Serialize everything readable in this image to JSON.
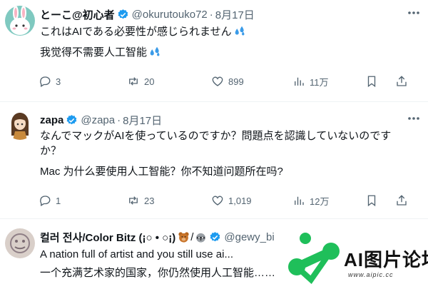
{
  "tweets": [
    {
      "name": "とーこ@初心者",
      "handle": "@okurutouko72",
      "dot": "·",
      "date": "8月17日",
      "lines": [
        "これはAIである必要性が感じられません",
        "我觉得不需要人工智能"
      ],
      "actions": {
        "replies": "3",
        "reposts": "20",
        "likes": "899",
        "views": "11万"
      },
      "icons": {
        "avatar": "bunny-avatar",
        "emoji": "sweat-droplets-emoji"
      }
    },
    {
      "name": "zapa",
      "handle": "@zapa",
      "dot": "·",
      "date": "8月17日",
      "lines": [
        "なんでマックがAIを使っているのですか？問題点を認識していないのですか？",
        "Mac 为什么要使用人工智能？你不知道问题所在吗?"
      ],
      "line1a": "なんでマックがAIを使っているのですか？問題点を認識していないのです",
      "line1b": "か？",
      "actions": {
        "replies": "1",
        "reposts": "23",
        "likes": "1,019",
        "views": "12万"
      },
      "icons": {
        "avatar": "anime-girl-avatar"
      }
    },
    {
      "name": "컬러 전사/Color Bitz (¡○ • ○¡)",
      "handle": "@gewy_bi",
      "lines": [
        "A nation full of artist and you still use ai...",
        "一个充满艺术家的国家，你仍然使用人工智能……"
      ],
      "icons": {
        "avatar": "doodle-avatar",
        "extra": [
          "bear-emoji",
          "raccoon-emoji"
        ]
      }
    }
  ],
  "watermark": {
    "text": "AI图片论坛",
    "url": "www.aipic.cc"
  },
  "colors": {
    "verified": "#1d9bf0",
    "secondary": "#536471",
    "emoji": "#3b9be8",
    "watermark": "#1fbf5a"
  }
}
